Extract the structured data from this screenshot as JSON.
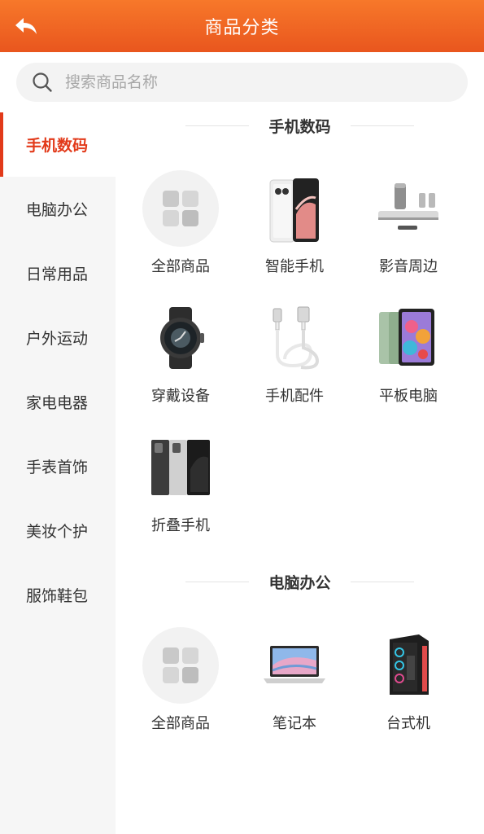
{
  "header": {
    "title": "商品分类",
    "back_icon": "back-arrow-icon"
  },
  "search": {
    "placeholder": "搜索商品名称",
    "value": "",
    "icon": "search-icon"
  },
  "sidebar": {
    "active_color": "#e23a1a",
    "items": [
      {
        "label": "手机数码",
        "active": true
      },
      {
        "label": "电脑办公"
      },
      {
        "label": "日常用品"
      },
      {
        "label": "户外运动"
      },
      {
        "label": "家电电器"
      },
      {
        "label": "手表首饰"
      },
      {
        "label": "美妆个护"
      },
      {
        "label": "服饰鞋包"
      }
    ]
  },
  "sections": [
    {
      "title": "手机数码",
      "items": [
        {
          "label": "全部商品",
          "icon": "all-goods-icon"
        },
        {
          "label": "智能手机",
          "icon": "smartphone-icon"
        },
        {
          "label": "影音周边",
          "icon": "speaker-icon"
        },
        {
          "label": "穿戴设备",
          "icon": "smartwatch-icon"
        },
        {
          "label": "手机配件",
          "icon": "usb-cable-icon"
        },
        {
          "label": "平板电脑",
          "icon": "tablet-icon"
        },
        {
          "label": "折叠手机",
          "icon": "foldable-phone-icon"
        }
      ]
    },
    {
      "title": "电脑办公",
      "items": [
        {
          "label": "全部商品",
          "icon": "all-goods-icon"
        },
        {
          "label": "笔记本",
          "icon": "laptop-icon"
        },
        {
          "label": "台式机",
          "icon": "desktop-pc-icon"
        }
      ]
    }
  ]
}
